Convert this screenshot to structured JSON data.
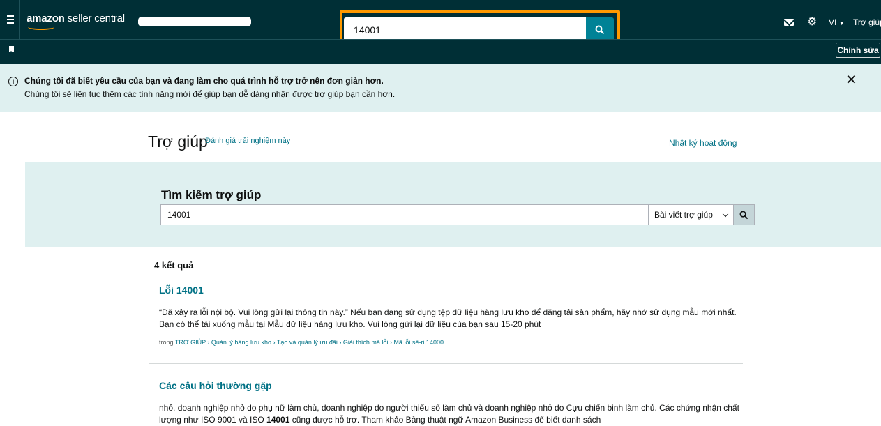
{
  "topbar": {
    "logo_brand": "amazon",
    "logo_suffix": " seller central",
    "search_value": "14001",
    "language": "VI",
    "help_link": "Trợ giúp",
    "edit_label": "Chỉnh sửa"
  },
  "banner": {
    "title": "Chúng tôi đã biết yêu cầu của bạn và đang làm cho quá trình hỗ trợ trở nên đơn giản hơn.",
    "text": "Chúng tôi sẽ liên tục thêm các tính năng mới để giúp bạn dễ dàng nhận được trợ giúp bạn cần hơn.",
    "close": "✕",
    "info": "i"
  },
  "help_header": {
    "title": "Trợ giúp",
    "rate_link": "Đánh giá trải nghiệm này",
    "activity_link": "Nhật ký hoạt động"
  },
  "search": {
    "heading": "Tìm kiếm trợ giúp",
    "value": "14001",
    "scope": "Bài viết trợ giúp"
  },
  "results": {
    "count": "4 kết quả",
    "items": [
      {
        "title": "Lỗi 14001",
        "snippet_line1": "“Đã xảy ra lỗi nội bộ. Vui lòng gửi lại thông tin này.” Nếu bạn đang sử dụng tệp dữ liệu hàng lưu kho để đăng tải sản phẩm, hãy nhớ sử dụng mẫu mới nhất.",
        "snippet_line2": "Bạn có thể tải xuống mẫu tại Mẫu dữ liệu hàng lưu kho. Vui lòng gửi lại dữ liệu của bạn sau 15-20 phút",
        "path_prefix": "trong ",
        "path": "TRỢ GIÚP › Quản lý hàng lưu kho › Tạo và quản lý ưu đãi › Giải thích mã lỗi › Mã lỗi sê-ri 14000"
      },
      {
        "title": "Các câu hỏi thường gặp",
        "snippet_line1": "nhỏ, doanh nghiệp nhỏ do phụ nữ làm chủ, doanh nghiệp do người thiểu số làm chủ và doanh nghiệp nhỏ do Cựu chiến binh làm chủ. Các chứng nhận chất",
        "snippet_line2_a": "lượng như ISO 9001 và ISO ",
        "snippet_line2_bold": "14001",
        "snippet_line2_b": " cũng được hỗ trợ. Tham khảo Bảng thuật ngữ Amazon Business để biết danh sách"
      }
    ]
  },
  "colors": {
    "nav_bg": "#002f36",
    "accent": "#008296",
    "highlight": "#ff9900",
    "link": "#007185",
    "panel_bg": "#dff0f0"
  }
}
